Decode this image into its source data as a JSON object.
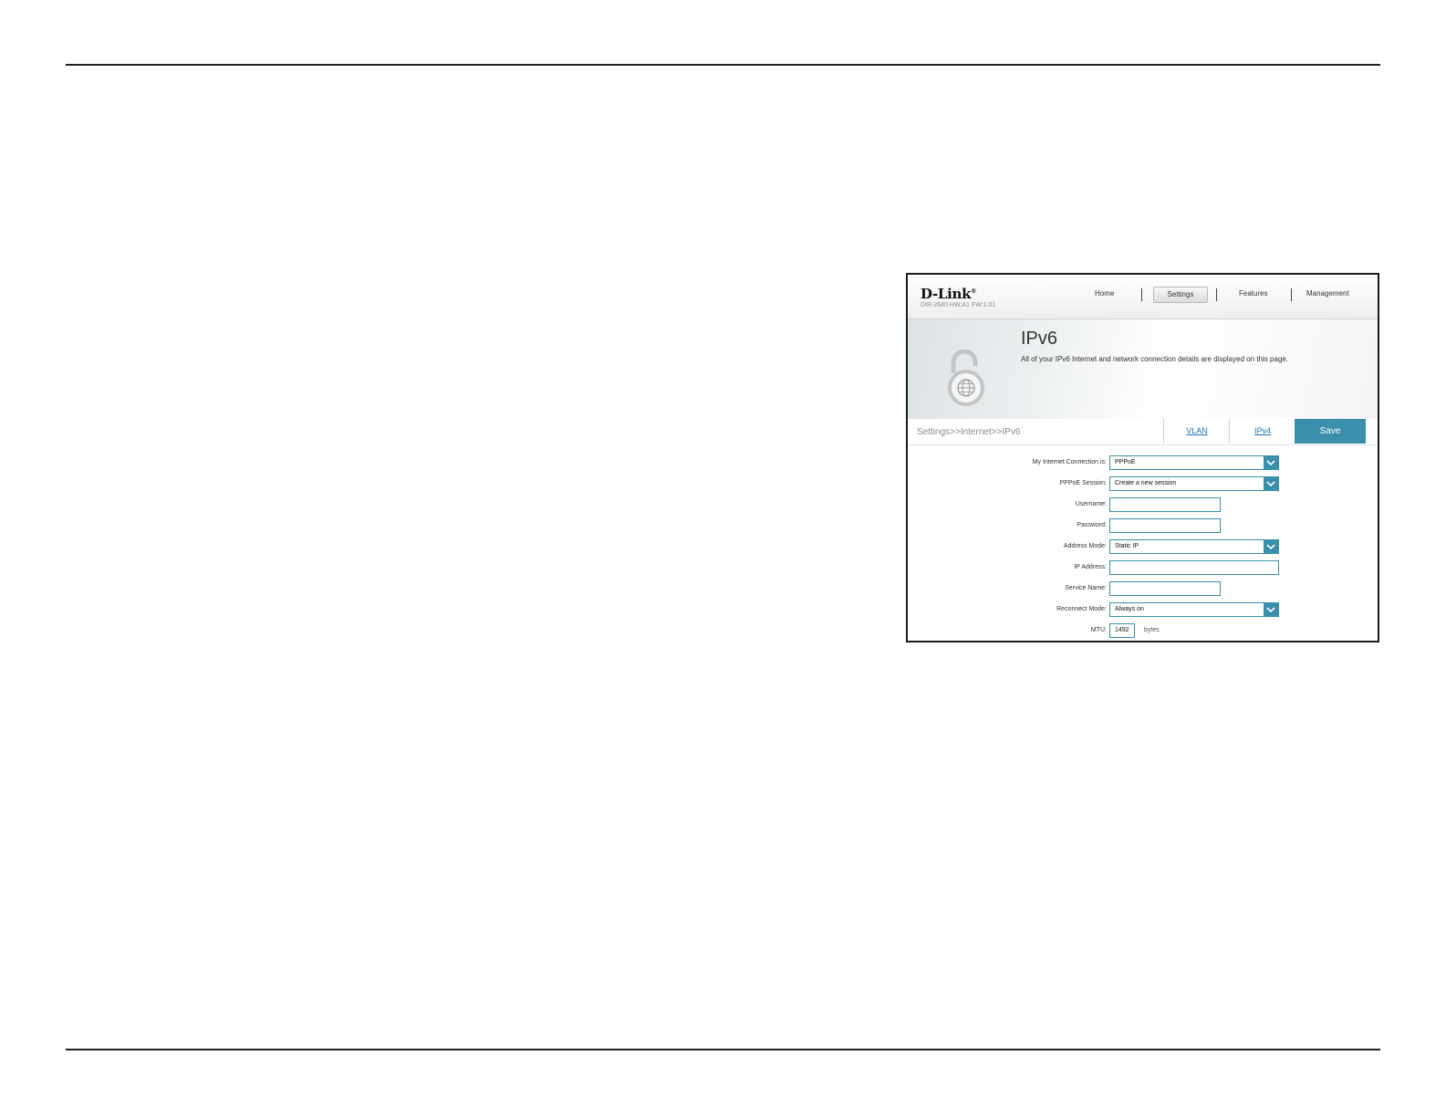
{
  "router": {
    "brand": "D-Link",
    "model_info": "DIR-2640 HW:A1 FW:1.01",
    "nav": {
      "home": "Home",
      "settings": "Settings",
      "features": "Features",
      "management": "Management"
    },
    "page_title": "IPv6",
    "page_description": "All of your IPv6 Internet and network connection details are displayed on this page.",
    "breadcrumb": "Settings>>Internet>>IPv6",
    "tabs": {
      "vlan": "VLAN",
      "ipv4": "IPv4"
    },
    "save_label": "Save",
    "form": {
      "connection_label": "My Internet Connection is:",
      "connection_value": "PPPoE",
      "session_label": "PPPoE Session:",
      "session_value": "Create a new session",
      "username_label": "Username:",
      "username_value": "",
      "password_label": "Password:",
      "password_value": "",
      "address_mode_label": "Address Mode:",
      "address_mode_value": "Static IP",
      "ip_label": "IP Address:",
      "ip_value": "",
      "service_label": "Service Name:",
      "service_value": "",
      "reconnect_label": "Reconnect Mode:",
      "reconnect_value": "Always on",
      "mtu_label": "MTU:",
      "mtu_value": "1492",
      "mtu_unit": "bytes"
    },
    "accent_color": "#3a8faa",
    "link_color": "#1b75bc"
  },
  "icons": [
    "lock-globe-icon",
    "chevron-down-icon"
  ]
}
